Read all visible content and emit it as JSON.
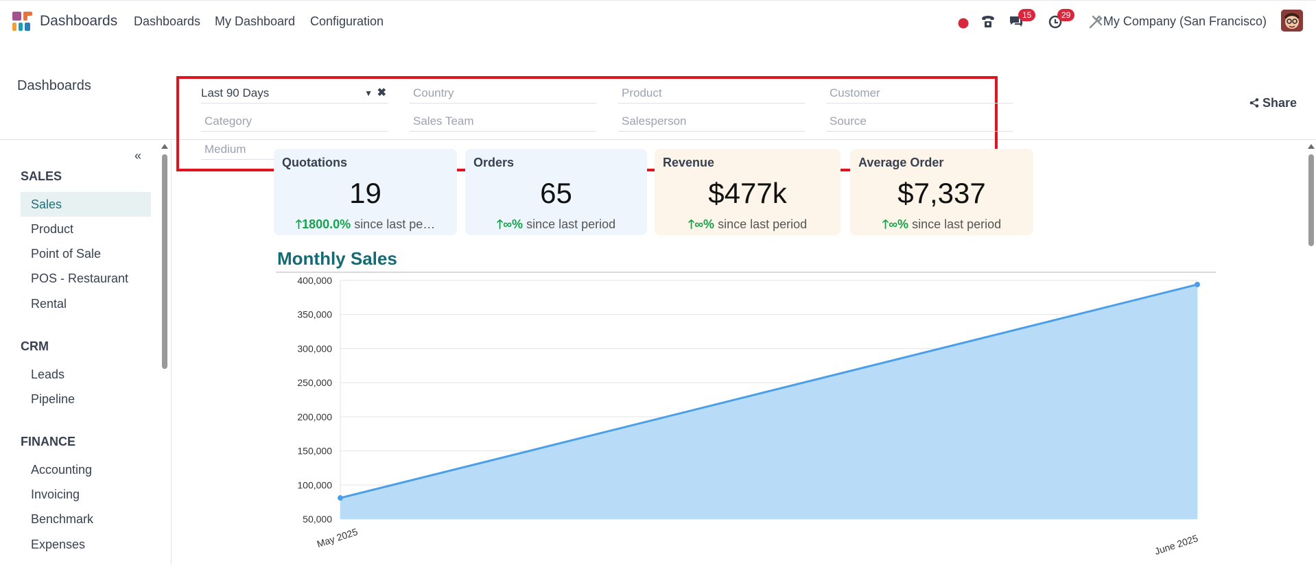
{
  "topbar": {
    "app_title": "Dashboards",
    "menu": [
      "Dashboards",
      "My Dashboard",
      "Configuration"
    ],
    "messages_count": "15",
    "activities_count": "29",
    "company": "My Company (San Francisco)"
  },
  "control": {
    "breadcrumb": "Dashboards",
    "share_label": "Share",
    "filters": {
      "period": "Last 90 Days",
      "country": "Country",
      "product": "Product",
      "customer": "Customer",
      "category": "Category",
      "sales_team": "Sales Team",
      "salesperson": "Salesperson",
      "source": "Source",
      "medium": "Medium"
    }
  },
  "sidebar": {
    "sections": [
      {
        "title": "SALES",
        "items": [
          "Sales",
          "Product",
          "Point of Sale",
          "POS - Restaurant",
          "Rental"
        ]
      },
      {
        "title": "CRM",
        "items": [
          "Leads",
          "Pipeline"
        ]
      },
      {
        "title": "FINANCE",
        "items": [
          "Accounting",
          "Invoicing",
          "Benchmark",
          "Expenses"
        ]
      }
    ],
    "active": "Sales"
  },
  "kpis": [
    {
      "title": "Quotations",
      "value": "19",
      "trend_value": "1800.0%",
      "trend_text": "since last pe…",
      "color": "#eef5fd"
    },
    {
      "title": "Orders",
      "value": "65",
      "trend_value": "∞%",
      "trend_text": "since last period",
      "color": "#eef5fd"
    },
    {
      "title": "Revenue",
      "value": "$477k",
      "trend_value": "∞%",
      "trend_text": "since last period",
      "color": "#fdf4ea"
    },
    {
      "title": "Average Order",
      "value": "$7,337",
      "trend_value": "∞%",
      "trend_text": "since last period",
      "color": "#fdf4ea"
    }
  ],
  "chart_data": {
    "type": "area",
    "title": "Monthly Sales",
    "categories": [
      "May 2025",
      "June 2025"
    ],
    "values": [
      81000,
      394000
    ],
    "ylim": [
      50000,
      400000
    ],
    "yticks": [
      "400,000",
      "350,000",
      "300,000",
      "250,000",
      "200,000",
      "150,000",
      "100,000",
      "50,000"
    ],
    "grid": true,
    "line_color": "#4a9fe8",
    "fill_color": "#b8dbf7"
  }
}
